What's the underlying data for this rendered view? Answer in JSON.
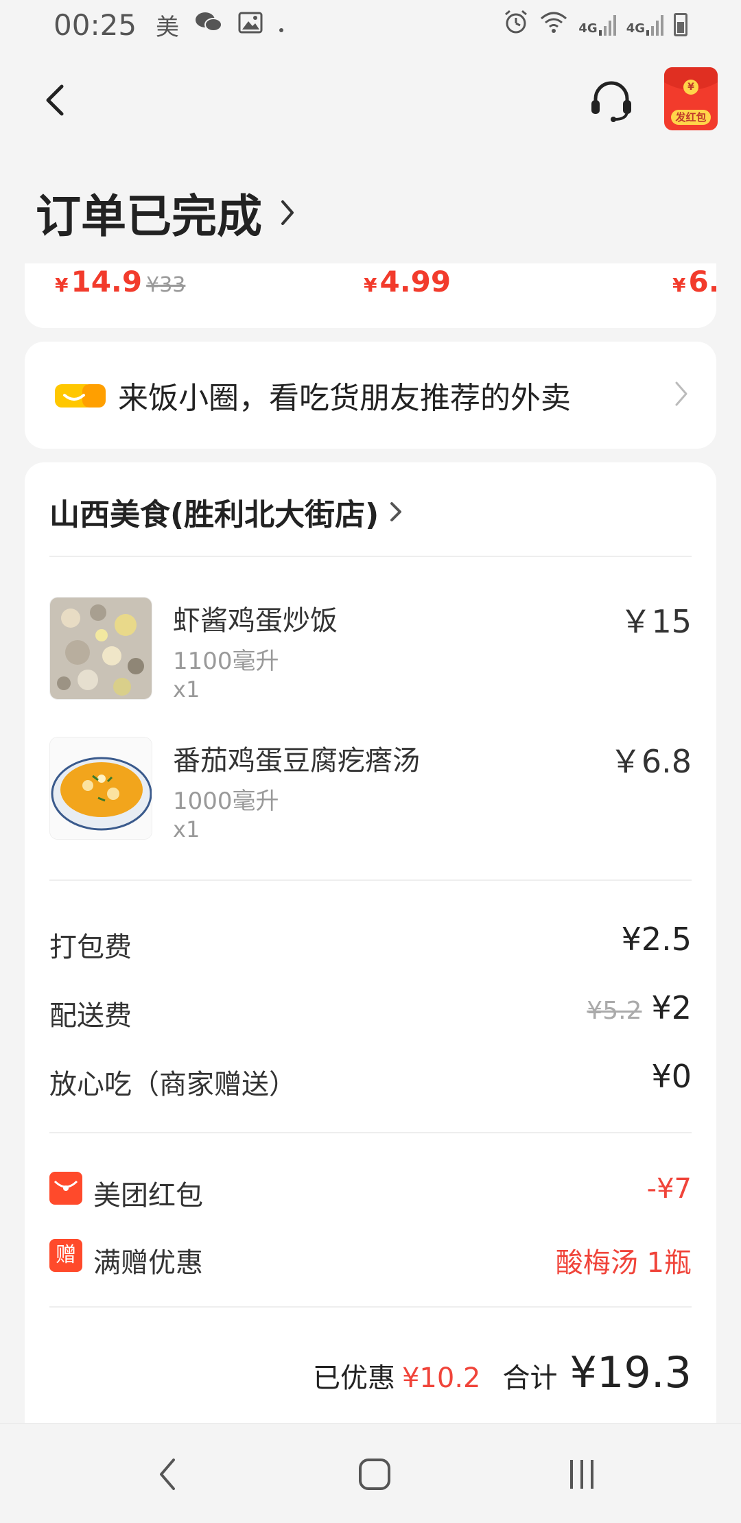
{
  "status_bar": {
    "time": "00:25",
    "app_glyph": "美",
    "icons": [
      "meituan-icon",
      "wechat-icon",
      "gallery-icon",
      "dot-icon",
      "alarm-icon",
      "wifi-icon",
      "signal-4g-icon",
      "battery-icon"
    ],
    "network_1": "4G",
    "network_2": "4G"
  },
  "header": {
    "redpacket_label": "发红包",
    "coin_symbol": "¥"
  },
  "page": {
    "title": "订单已完成"
  },
  "recommendations": {
    "prices": [
      {
        "yen": "¥",
        "value": "14.9",
        "original": "¥33"
      },
      {
        "yen": "¥",
        "value": "4.99",
        "original": ""
      },
      {
        "yen": "¥",
        "value": "6.",
        "original": ""
      }
    ]
  },
  "circle_banner": {
    "text": "来饭小圈，看吃货朋友推荐的外卖"
  },
  "order": {
    "store_name": "山西美食(胜利北大街店)",
    "items": [
      {
        "name": "虾酱鸡蛋炒饭",
        "spec": "1100毫升",
        "qty": "x1",
        "price": "￥15"
      },
      {
        "name": "番茄鸡蛋豆腐疙瘩汤",
        "spec": "1000毫升",
        "qty": "x1",
        "price": "￥6.8"
      }
    ],
    "fees": {
      "packing_label": "打包费",
      "packing_value": "¥2.5",
      "delivery_label": "配送费",
      "delivery_original": "¥5.2",
      "delivery_value": "¥2",
      "safe_label": "放心吃（商家赠送）",
      "safe_value": "¥0"
    },
    "promos": [
      {
        "label": "美团红包",
        "value": "-¥7",
        "icon": "red-envelope-icon"
      },
      {
        "label": "满赠优惠",
        "value": "酸梅汤 1瓶",
        "icon_text": "赠",
        "icon": "gift-icon"
      }
    ],
    "summary": {
      "discount_label": "已优惠",
      "discount_value": "¥10.2",
      "total_label": "合计",
      "total_value": "¥19.3"
    }
  },
  "colors": {
    "accent": "#f23b2c",
    "promo": "#f0443a",
    "background": "#f4f4f4",
    "card": "#ffffff",
    "circle_yellow": "#ffc700"
  }
}
